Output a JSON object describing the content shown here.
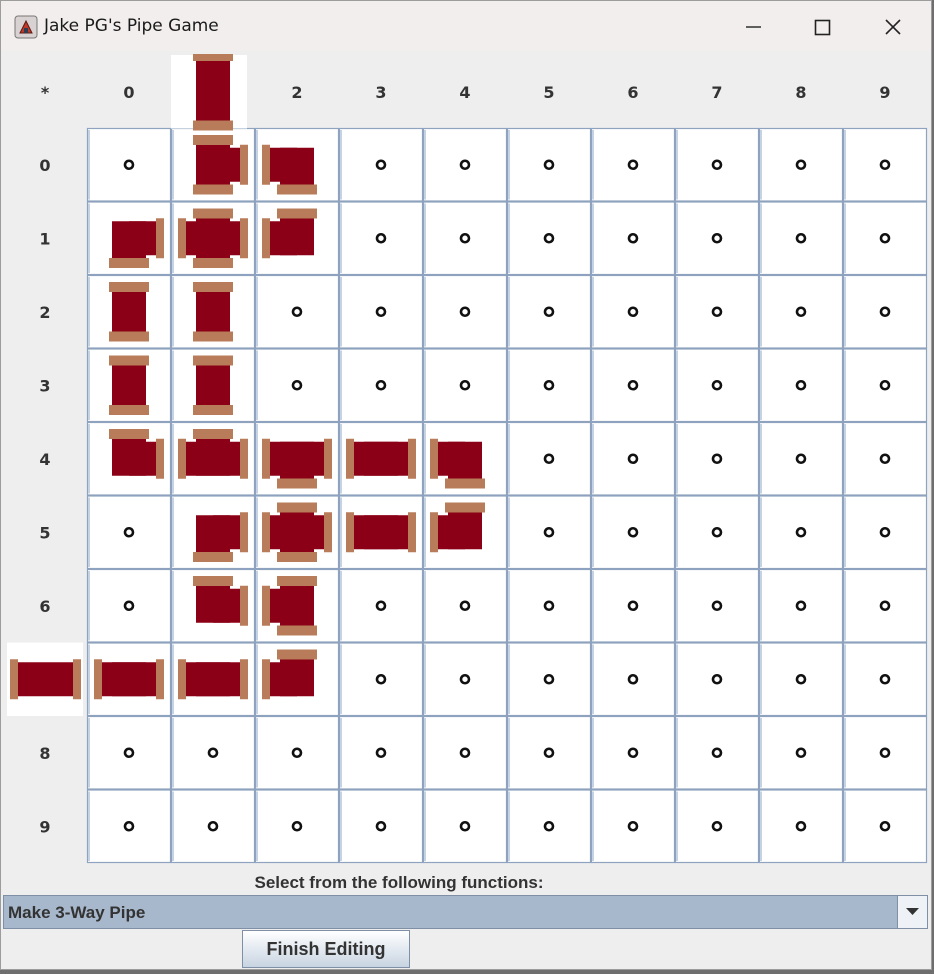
{
  "window": {
    "title": "Jake PG's Pipe Game"
  },
  "grid": {
    "corner_label": "*",
    "column_headers": [
      "0",
      "1",
      "2",
      "3",
      "4",
      "5",
      "6",
      "7",
      "8",
      "9"
    ],
    "row_headers": [
      "0",
      "1",
      "2",
      "3",
      "4",
      "5",
      "6",
      "7",
      "8",
      "9"
    ],
    "pipe_color": "#8b0016",
    "joint_color": "#b87c5a",
    "empty_cell_marker": "ring",
    "source": {
      "position": "above column 1",
      "opening": "down"
    },
    "drain": {
      "position": "left of row 7",
      "opening": "right"
    },
    "pipes": [
      {
        "row": 0,
        "col": 1,
        "openings": [
          "up",
          "down",
          "right"
        ]
      },
      {
        "row": 0,
        "col": 2,
        "openings": [
          "left",
          "down"
        ]
      },
      {
        "row": 1,
        "col": 0,
        "openings": [
          "right",
          "down"
        ]
      },
      {
        "row": 1,
        "col": 1,
        "openings": [
          "up",
          "down",
          "left",
          "right"
        ]
      },
      {
        "row": 1,
        "col": 2,
        "openings": [
          "up",
          "left"
        ]
      },
      {
        "row": 2,
        "col": 0,
        "openings": [
          "up",
          "down"
        ]
      },
      {
        "row": 2,
        "col": 1,
        "openings": [
          "up",
          "down"
        ]
      },
      {
        "row": 3,
        "col": 0,
        "openings": [
          "up",
          "down"
        ]
      },
      {
        "row": 3,
        "col": 1,
        "openings": [
          "up",
          "down"
        ]
      },
      {
        "row": 4,
        "col": 0,
        "openings": [
          "up",
          "right"
        ]
      },
      {
        "row": 4,
        "col": 1,
        "openings": [
          "up",
          "left",
          "right"
        ]
      },
      {
        "row": 4,
        "col": 2,
        "openings": [
          "left",
          "right",
          "down"
        ]
      },
      {
        "row": 4,
        "col": 3,
        "openings": [
          "left",
          "right"
        ]
      },
      {
        "row": 4,
        "col": 4,
        "openings": [
          "left",
          "down"
        ]
      },
      {
        "row": 5,
        "col": 1,
        "openings": [
          "right",
          "down"
        ]
      },
      {
        "row": 5,
        "col": 2,
        "openings": [
          "up",
          "down",
          "left",
          "right"
        ]
      },
      {
        "row": 5,
        "col": 3,
        "openings": [
          "left",
          "right"
        ]
      },
      {
        "row": 5,
        "col": 4,
        "openings": [
          "up",
          "left"
        ]
      },
      {
        "row": 6,
        "col": 1,
        "openings": [
          "up",
          "right"
        ]
      },
      {
        "row": 6,
        "col": 2,
        "openings": [
          "up",
          "down",
          "left"
        ]
      },
      {
        "row": 7,
        "col": 0,
        "openings": [
          "left",
          "right"
        ]
      },
      {
        "row": 7,
        "col": 1,
        "openings": [
          "left",
          "right"
        ]
      },
      {
        "row": 7,
        "col": 2,
        "openings": [
          "up",
          "left"
        ]
      }
    ]
  },
  "controls": {
    "functions_label": "Select from the following functions:",
    "selected_function": "Make 3-Way Pipe",
    "finish_button": "Finish Editing"
  }
}
